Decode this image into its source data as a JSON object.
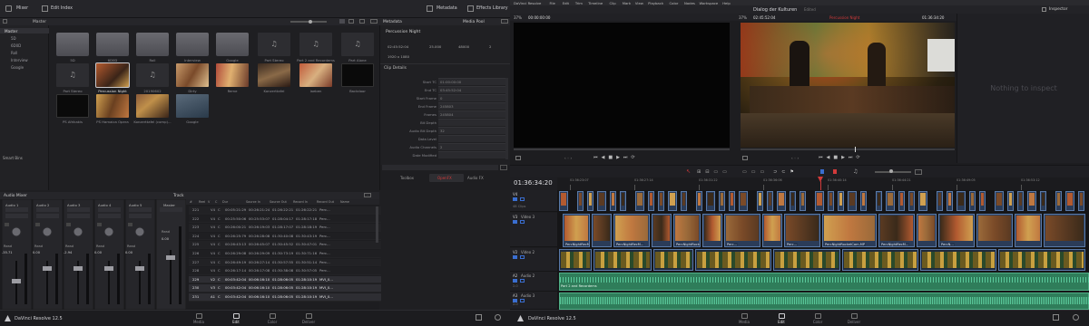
{
  "left": {
    "topbar": {
      "mixer": "Mixer",
      "edit_index": "Edit Index",
      "metadata": "Metadata",
      "effects_library": "Effects Library"
    },
    "mediapool": {
      "header": "Master",
      "bins": [
        "Master",
        "5D",
        "6D0D",
        "Roll",
        "Interview",
        "Google"
      ],
      "smart_bins": "Smart Bins",
      "clips_row1": [
        "5D",
        "6D0D",
        "Roll",
        "Interview",
        "Google",
        "Part Stereo",
        "Part 2 and Recordems",
        "Part Alone"
      ],
      "clips_row2": [
        "Part Stereo",
        "Percussion Night",
        "20190602",
        "Dirty",
        "Reme",
        "Konzerttafel",
        "laeben",
        "Backdoor"
      ],
      "clips_row3": [
        "PS Afrikakis",
        "PS Hamaica Opera",
        "Konzerttafel (comp)...",
        "Google"
      ]
    },
    "metadata_panel": {
      "title": "Metadata",
      "media_pool": "Media Pool",
      "clip_name": "Percussion Night",
      "stats": [
        "02:45:52:04",
        "25.000",
        "48000",
        "2",
        "1920 x 1080"
      ],
      "section": "Clip Details",
      "fields": [
        {
          "label": "Start TC",
          "value": "01:00:00:00"
        },
        {
          "label": "End TC",
          "value": "03:45:52:04"
        },
        {
          "label": "Start Frame",
          "value": "0"
        },
        {
          "label": "End Frame",
          "value": "245803"
        },
        {
          "label": "Frames",
          "value": "245804"
        },
        {
          "label": "Bit Depth",
          "value": ""
        },
        {
          "label": "Audio Bit Depth",
          "value": "32"
        },
        {
          "label": "Data Level",
          "value": ""
        },
        {
          "label": "Audio Channels",
          "value": "2"
        },
        {
          "label": "Date Modified",
          "value": ""
        }
      ],
      "tabs": [
        "Toolbox",
        "OpenFX",
        "Audio FX"
      ],
      "active_tab": "OpenFX"
    },
    "audio_mixer": {
      "title": "Audio Mixer",
      "strips": [
        "Audio 1",
        "Audio 2",
        "Audio 3",
        "Audio 4",
        "Audio 5",
        "Master"
      ],
      "read": "Read",
      "values": [
        "-35.71",
        "0.00",
        "-2.94",
        "0.00",
        "0.00",
        "0.00"
      ]
    },
    "track_index": {
      "title": "Track",
      "columns": [
        "#",
        "Reel",
        "V",
        "C",
        "Dur",
        "Source In",
        "Source Out",
        "Record In",
        "Record Out",
        "Name"
      ],
      "rows": [
        [
          "221",
          "V4",
          "C",
          "00:05:21:29",
          "00:26:21:24",
          "01:26:22:21",
          "01:26:22:21",
          "Perc..."
        ],
        [
          "222",
          "V4",
          "C",
          "00:25:50:06",
          "00:25:53:07",
          "01:28:04:17",
          "01:28:17:18",
          "Perc..."
        ],
        [
          "223",
          "V4",
          "C",
          "00:26:00:21",
          "00:26:19:03",
          "01:28:17:07",
          "01:28:18:19",
          "Perc..."
        ],
        [
          "224",
          "V4",
          "C",
          "00:26:25:79",
          "00:26:28:08",
          "01:30:40:08",
          "01:30:43:19",
          "Perc..."
        ],
        [
          "225",
          "V4",
          "C",
          "00:26:43:13",
          "00:26:45:07",
          "01:30:45:52",
          "01:30:47:01",
          "Perc..."
        ],
        [
          "226",
          "V4",
          "C",
          "00:26:29:08",
          "00:26:29:09",
          "01:30:73:19",
          "01:30:71:16",
          "Perc..."
        ],
        [
          "227",
          "V4",
          "C",
          "00:26:49:19",
          "00:26:27:14",
          "01:30:57:55",
          "01:30:51:14",
          "Perc..."
        ],
        [
          "228",
          "V4",
          "C",
          "00:26:17:14",
          "00:26:17:08",
          "01:30:38:08",
          "01:30:57:05",
          "Perc..."
        ],
        [
          "229",
          "V2",
          "C",
          "00:03:42:04",
          "00:06:16:10",
          "01:28:06:05",
          "01:28:10:19",
          "MVI_0..."
        ],
        [
          "230",
          "V3",
          "C",
          "00:03:42:04",
          "00:06:16:10",
          "01:28:06:05",
          "01:28:10:19",
          "MVI_0..."
        ],
        [
          "231",
          "A1",
          "C",
          "00:03:42:04",
          "00:06:16:10",
          "01:28:06:05",
          "01:28:10:19",
          "MVI_0..."
        ]
      ],
      "selected_rows": [
        8,
        9,
        10
      ]
    },
    "app_name": "DaVinci Resolve 12.5",
    "pages": [
      "Media",
      "Edit",
      "Color",
      "Deliver"
    ],
    "active_page": "Edit"
  },
  "right": {
    "menubar": [
      "DaVinci Resolve",
      "File",
      "Edit",
      "Trim",
      "Timeline",
      "Clip",
      "Mark",
      "View",
      "Playback",
      "Color",
      "Nodes",
      "Workspace",
      "Help"
    ],
    "project_title": "Dialog der Kulturen",
    "project_status": "Edited",
    "inspector": "Inspector",
    "source": {
      "zoom": "37%",
      "timecode": "00:00:00:00"
    },
    "program": {
      "zoom": "37%",
      "timecode": "02:45:52:04",
      "clip": "Percussion Night",
      "record_tc": "01:36:34:20"
    },
    "nothing_to_inspect": "Nothing to inspect",
    "timeline_tc": "01:36:34:20",
    "ruler": [
      "01:36:23:07",
      "01:36:27:14",
      "01:36:31:22",
      "01:36:36:06",
      "01:36:40:14",
      "01:36:44:21",
      "01:36:49:05",
      "01:36:53:12"
    ],
    "tracks": [
      {
        "id": "V4",
        "name": "",
        "clips": "48 Clips"
      },
      {
        "id": "V3",
        "name": "Video 3",
        "clips": ""
      },
      {
        "id": "V2",
        "name": "Video 2",
        "clips": ""
      },
      {
        "id": "A2",
        "name": "Audio 2",
        "clips": "2.0"
      },
      {
        "id": "A3",
        "name": "Audio 3",
        "clips": "2.0"
      }
    ],
    "clip_labels": [
      "PercNightRecM...",
      "PercNightRecM...",
      "PercNightRocketCam.MP",
      "Perc...",
      "Perc...",
      "PercNightRocketCam.MP",
      "PercNightRecM...",
      "PercN..."
    ],
    "audio_label": "Part 2 and Recordems",
    "app_name": "DaVinci Resolve 12.5",
    "pages": [
      "Media",
      "Edit",
      "Color",
      "Deliver"
    ],
    "active_page": "Edit"
  },
  "colors": {
    "accent_red": "#d23a3a",
    "timeline_blue": "#2b3c58",
    "audio_green": "#2f7d5a",
    "panel": "#1f1f22"
  }
}
